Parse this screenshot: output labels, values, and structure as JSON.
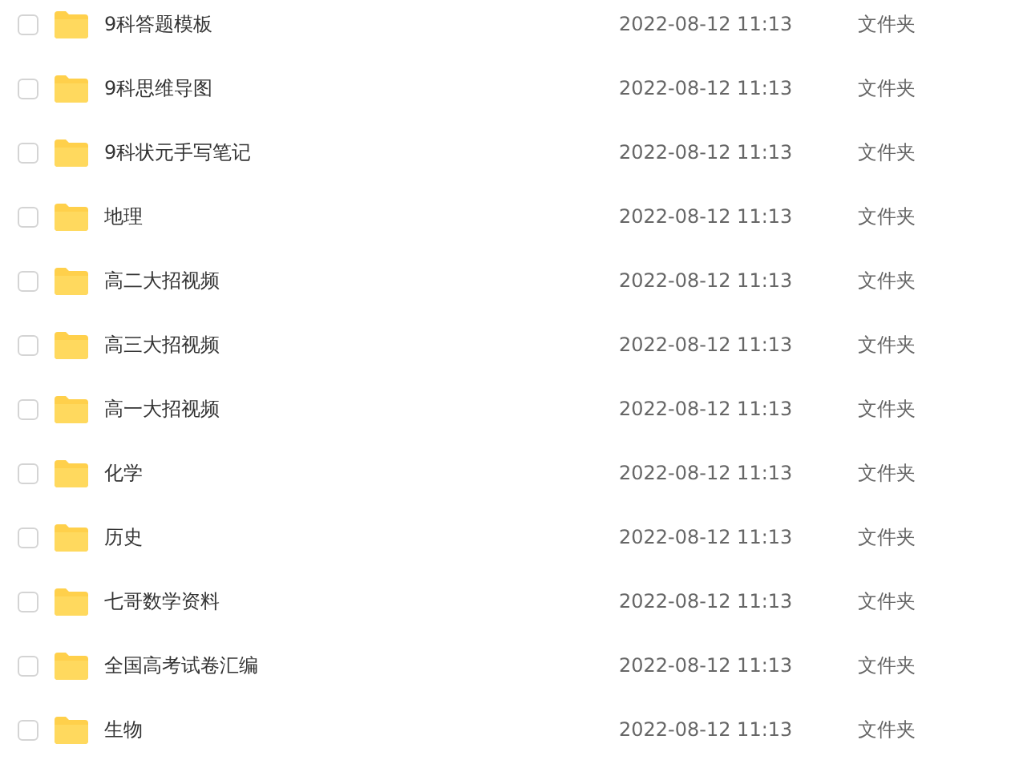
{
  "files": [
    {
      "name": "9科答题模板",
      "modified": "2022-08-12 11:13",
      "type": "文件夹",
      "checked": false
    },
    {
      "name": "9科思维导图",
      "modified": "2022-08-12 11:13",
      "type": "文件夹",
      "checked": false
    },
    {
      "name": "9科状元手写笔记",
      "modified": "2022-08-12 11:13",
      "type": "文件夹",
      "checked": false
    },
    {
      "name": "地理",
      "modified": "2022-08-12 11:13",
      "type": "文件夹",
      "checked": false
    },
    {
      "name": "高二大招视频",
      "modified": "2022-08-12 11:13",
      "type": "文件夹",
      "checked": false
    },
    {
      "name": "高三大招视频",
      "modified": "2022-08-12 11:13",
      "type": "文件夹",
      "checked": false
    },
    {
      "name": "高一大招视频",
      "modified": "2022-08-12 11:13",
      "type": "文件夹",
      "checked": false
    },
    {
      "name": "化学",
      "modified": "2022-08-12 11:13",
      "type": "文件夹",
      "checked": false
    },
    {
      "name": "历史",
      "modified": "2022-08-12 11:13",
      "type": "文件夹",
      "checked": false
    },
    {
      "name": "七哥数学资料",
      "modified": "2022-08-12 11:13",
      "type": "文件夹",
      "checked": false
    },
    {
      "name": "全国高考试卷汇编",
      "modified": "2022-08-12 11:13",
      "type": "文件夹",
      "checked": false
    },
    {
      "name": "生物",
      "modified": "2022-08-12 11:13",
      "type": "文件夹",
      "checked": false
    }
  ]
}
